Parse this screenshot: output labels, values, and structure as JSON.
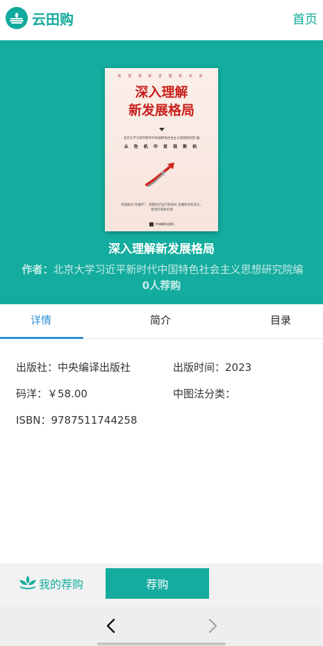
{
  "header": {
    "app_name": "云田购",
    "home_link": "首页",
    "logo_icon": "cloud-field-icon",
    "brand_color": "#12aa9c"
  },
  "book": {
    "title": "深入理解新发展格局",
    "author_label": "作者：",
    "author": "北京大学习近平新时代中国特色社会主义思想研究院编",
    "recommend_count": "0人荐购",
    "cover": {
      "top_line": "新 视 角   新 发 展   新 未 来",
      "title_line1": "深入理解",
      "title_line2": "新发展格局",
      "editor": "北京大学习近平新时代中国特色社会主义思想研究院  编",
      "subtitle": "从 危 机 中 发 现 新 机",
      "note": "深度解读\"双循环\"，把握经济运行新格局 读懂经济新常态，看清宏观新机遇",
      "publisher": "中央编译出版社"
    }
  },
  "tabs": [
    {
      "label": "详情",
      "active": true
    },
    {
      "label": "简介",
      "active": false
    },
    {
      "label": "目录",
      "active": false
    }
  ],
  "details": {
    "publisher": "出版社：中央编译出版社",
    "pub_time": "出版时间：2023",
    "price": "码洋：￥58.00",
    "clc": "中图法分类：",
    "isbn": "ISBN：9787511744258"
  },
  "bottom": {
    "my_recommend": "我的荐购",
    "recommend_button": "荐购"
  },
  "nav": {
    "back_icon": "chevron-left-icon",
    "forward_icon": "chevron-right-icon"
  }
}
